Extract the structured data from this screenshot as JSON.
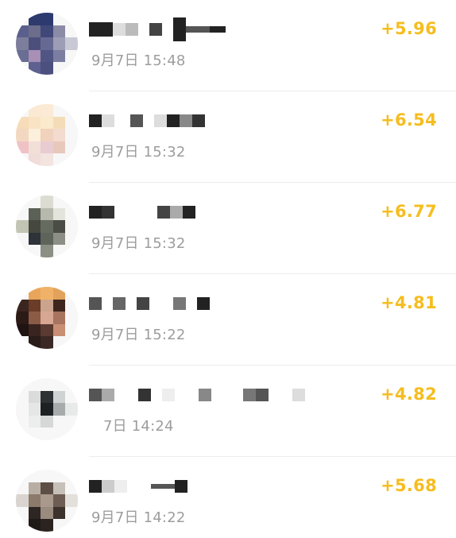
{
  "records": [
    {
      "time": "9月7日 15:48",
      "amount": "+5.96"
    },
    {
      "time": "9月7日 15:32",
      "amount": "+6.54"
    },
    {
      "time": "9月7日 15:32",
      "amount": "+6.77"
    },
    {
      "time": "9月7日 15:22",
      "amount": "+4.81"
    },
    {
      "time": "7日 14:24",
      "amount": "+4.82"
    },
    {
      "time": "9月7日 14:22",
      "amount": "+5.68"
    }
  ],
  "colors": {
    "amount": "#f5bd1f",
    "time": "#9d9d9d",
    "divider": "#ececec"
  }
}
